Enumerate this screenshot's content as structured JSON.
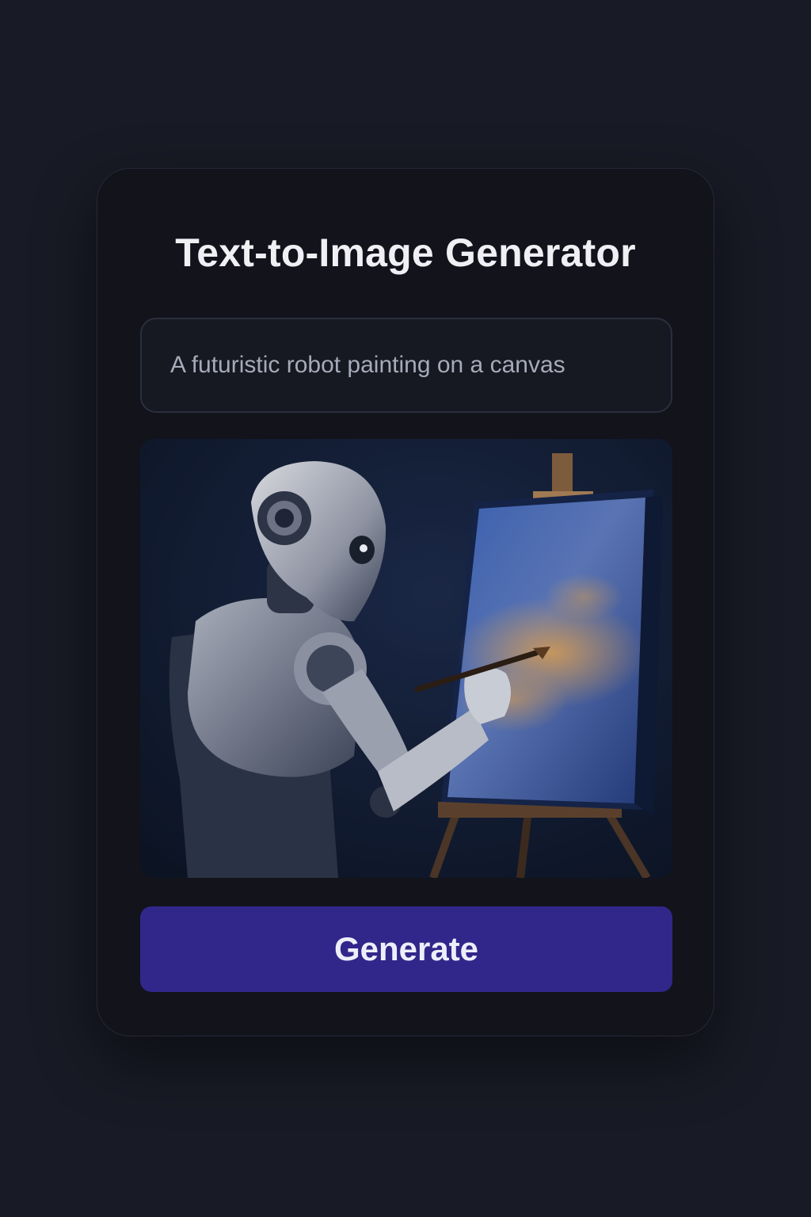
{
  "card": {
    "title": "Text-to-Image Generator"
  },
  "prompt": {
    "value": "A futuristic robot painting on a canvas"
  },
  "generated_image": {
    "subject": "robot painting on an easel canvas"
  },
  "actions": {
    "generate_label": "Generate"
  },
  "colors": {
    "background": "#181a25",
    "card": "#12131b",
    "accent": "#31278a"
  }
}
